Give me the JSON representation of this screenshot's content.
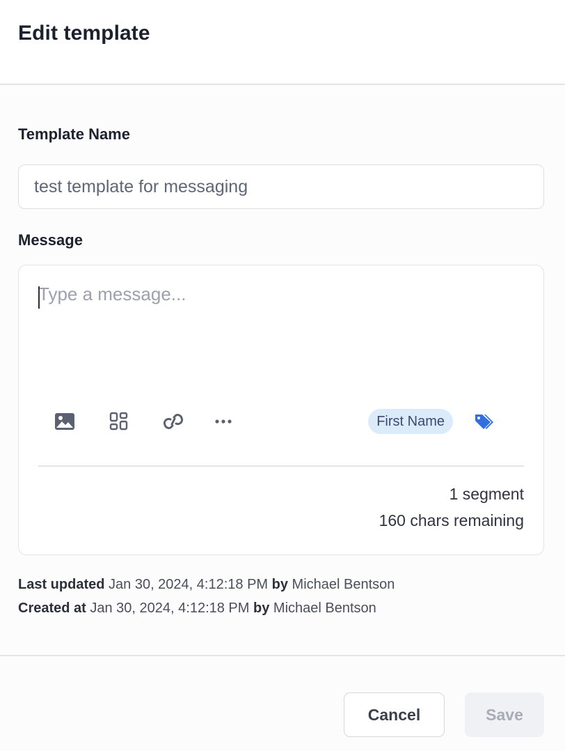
{
  "header": {
    "title": "Edit template"
  },
  "form": {
    "name_label": "Template Name",
    "name_value": "test template for messaging",
    "message_label": "Message",
    "message_placeholder": "Type a message...",
    "message_value": ""
  },
  "toolbar": {
    "icons": [
      "image-icon",
      "grid-icon",
      "link-icon",
      "more-icon",
      "tag-icon"
    ],
    "chip_label": "First Name"
  },
  "counter": {
    "segments": "1 segment",
    "remaining": "160 chars remaining"
  },
  "meta": {
    "updated_label": "Last updated",
    "updated_value": "Jan 30, 2024, 4:12:18 PM",
    "updated_by_label": "by",
    "updated_by": "Michael Bentson",
    "created_label": "Created at",
    "created_value": "Jan 30, 2024, 4:12:18 PM",
    "created_by_label": "by",
    "created_by": "Michael Bentson"
  },
  "footer": {
    "cancel_label": "Cancel",
    "save_label": "Save"
  },
  "colors": {
    "accent": "#2f6fe0",
    "chip_bg": "#dcebfa",
    "save_disabled_bg": "#f0f1f4"
  }
}
